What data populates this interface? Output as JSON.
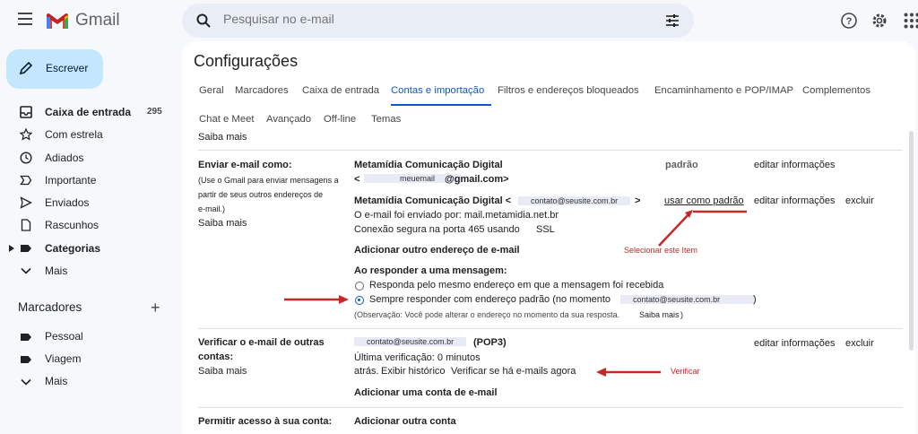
{
  "app": {
    "name": "Gmail"
  },
  "search": {
    "placeholder": "Pesquisar no e-mail"
  },
  "compose": {
    "label": "Escrever"
  },
  "nav": [
    {
      "label": "Caixa de entrada",
      "count": "295",
      "icon": "inbox-icon",
      "bold": true
    },
    {
      "label": "Com estrela",
      "icon": "star-icon"
    },
    {
      "label": "Adiados",
      "icon": "clock-icon"
    },
    {
      "label": "Importante",
      "icon": "important-icon"
    },
    {
      "label": "Enviados",
      "icon": "send-icon"
    },
    {
      "label": "Rascunhos",
      "icon": "draft-icon"
    },
    {
      "label": "Categorias",
      "icon": "label-icon",
      "bold": true
    },
    {
      "label": "Mais",
      "icon": "chevron-down-icon"
    }
  ],
  "labels": {
    "heading": "Marcadores",
    "items": [
      "Pessoal",
      "Viagem",
      "Mais"
    ]
  },
  "settings": {
    "title": "Configurações",
    "tabs_row1": [
      "Geral",
      "Marcadores",
      "Caixa de entrada",
      "Contas e importação",
      "Filtros e endereços bloqueados",
      "Encaminhamento e POP/IMAP",
      "Complementos"
    ],
    "tabs_row2": [
      "Chat e Meet",
      "Avançado",
      "Off-line",
      "Temas"
    ],
    "active_tab": "Contas e importação",
    "top_learn_more": "Saiba mais",
    "send_as": {
      "heading": "Enviar e-mail como:",
      "desc1": "(Use o Gmail para enviar mensagens a",
      "desc2": "partir de seus outros endereços de",
      "desc3": "e-mail.)",
      "learn_more": "Saiba mais",
      "account1_name": "Metamídia Comunicação Digital",
      "account1_lt": "<",
      "account1_email_user": "meuemail",
      "account1_email_domain": "@gmail.com>",
      "account1_default": "padrão",
      "account1_edit": "editar informações",
      "account2_name": "Metamídia Comunicação Digital <",
      "account2_email": "contato@seusite.com.br",
      "account2_gt": ">",
      "account2_use_default": "usar como padrão",
      "account2_edit": "editar informações",
      "account2_delete": "excluir",
      "account2_sent_by": "O e-mail foi enviado por: mail.metamidia.net.br",
      "account2_conn": "Conexão segura na porta 465 usando",
      "account2_ssl": "SSL",
      "add_address": "Adicionar outro endereço de e-mail",
      "annotation_select": "Selecionar este Item",
      "reply_heading": "Ao responder a uma mensagem:",
      "reply_opt1": "Responda pelo mesmo endereço em que a mensagem foi recebida",
      "reply_opt2": "Sempre responder com endereço padrão (no momento",
      "reply_opt2_email": "contato@seusite.com.br",
      "reply_opt2_close": ")",
      "reply_selected": 2,
      "note": "(Observação: Você pode alterar o endereço no momento da sua resposta.",
      "note_link": "Saiba mais",
      "note_close": ")"
    },
    "check_mail": {
      "heading1": "Verificar o e-mail de outras",
      "heading2": "contas:",
      "learn_more": "Saiba mais",
      "email": "contato@seusite.com.br",
      "type": "(POP3)",
      "last_check": "Última verificação: 0 minutos",
      "ago": "atrás.",
      "history": "Exibir histórico",
      "check_now": "Verificar se há e-mails agora",
      "edit": "editar informações",
      "delete": "excluir",
      "add_account": "Adicionar uma conta de e-mail",
      "annotation_verify": "Verificar"
    },
    "grant": {
      "heading": "Permitir acesso à sua conta:",
      "add": "Adicionar outra conta"
    }
  },
  "colors": {
    "accent": "#0b57d0",
    "annotation": "#c62828",
    "compose_bg": "#c2e7ff",
    "page_bg": "#f6f8fc"
  }
}
